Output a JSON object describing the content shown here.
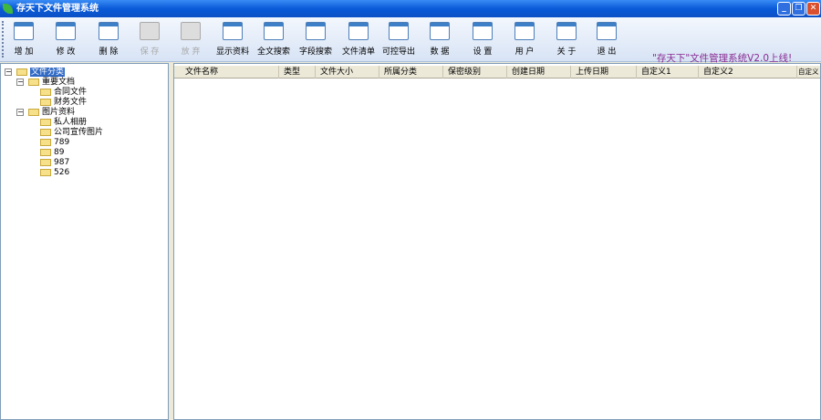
{
  "window": {
    "title": "存天下文件管理系统",
    "min": "_",
    "max": "❐",
    "close": "✕"
  },
  "toolbar": {
    "buttons": [
      {
        "label": "增 加",
        "icon": "add-icon"
      },
      {
        "label": "修 改",
        "icon": "edit-icon"
      },
      {
        "label": "删 除",
        "icon": "delete-icon"
      },
      {
        "label": "保 存",
        "icon": "save-icon",
        "disabled": true
      },
      {
        "label": "放 弃",
        "icon": "undo-icon",
        "disabled": true
      },
      {
        "label": "显示资料",
        "icon": "show-icon"
      },
      {
        "label": "全文搜索",
        "icon": "fulltext-search-icon"
      },
      {
        "label": "字段搜索",
        "icon": "binoculars-icon"
      },
      {
        "label": "文件清单",
        "icon": "excel-list-icon"
      },
      {
        "label": "可控导出",
        "icon": "export-icon"
      },
      {
        "label": "数 据",
        "icon": "data-icon"
      },
      {
        "label": "设 置",
        "icon": "settings-icon"
      },
      {
        "label": "用 户",
        "icon": "users-icon"
      },
      {
        "label": "关 于",
        "icon": "info-icon"
      },
      {
        "label": "退 出",
        "icon": "exit-icon"
      }
    ],
    "marquee": "\"存天下\"文件管理系统V2.0上线!"
  },
  "tree": {
    "root": "文件分类",
    "groups": [
      {
        "label": "重要文档",
        "children": [
          "合同文件",
          "财务文件"
        ]
      },
      {
        "label": "图片资料",
        "children": [
          "私人相册",
          "公司宣传图片",
          "789",
          "89",
          "987",
          "526"
        ]
      }
    ]
  },
  "list": {
    "columns": [
      "文件名称",
      "类型",
      "文件大小",
      "所属分类",
      "保密级别",
      "创建日期",
      "上传日期",
      "自定义1",
      "自定义2",
      "自定义"
    ]
  }
}
